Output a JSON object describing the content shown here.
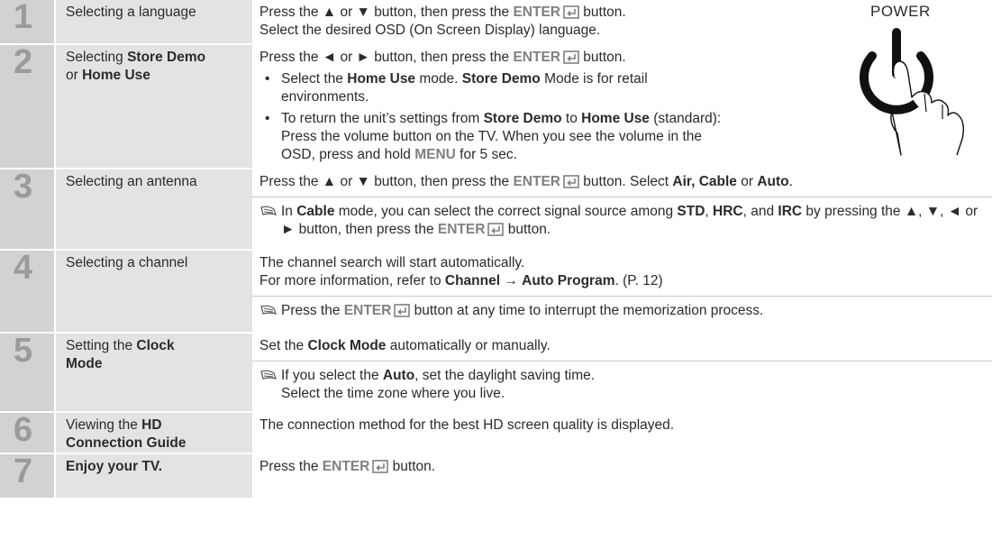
{
  "power_label": "POWER",
  "steps": [
    {
      "number": "1",
      "title_a": "Selecting a language",
      "title_b": "",
      "title_c": "",
      "title_d": ""
    },
    {
      "number": "2",
      "title_a": "Selecting ",
      "title_b": "Store Demo",
      "title_c": "or ",
      "title_d": "Home Use"
    },
    {
      "number": "3",
      "title_a": "Selecting an antenna"
    },
    {
      "number": "4",
      "title_a": "Selecting a channel"
    },
    {
      "number": "5",
      "title_a": "Setting the ",
      "title_b": "Clock",
      "title_c": "Mode"
    },
    {
      "number": "6",
      "title_a": "Viewing the ",
      "title_b": "HD",
      "title_c": "Connection Guide"
    },
    {
      "number": "7",
      "title_a": "Enjoy your TV."
    }
  ],
  "text": {
    "press_the": "Press the",
    "up_down": "▲ or ▼",
    "left_right": "◄ or ►",
    "button_then_press_the": "button, then press the",
    "enter": "ENTER",
    "button_period": "button.",
    "s1_line2": "Select the desired OSD (On Screen Display) language.",
    "s2_b1_a": "Select the ",
    "home_use": "Home Use",
    "s2_b1_b": " mode. ",
    "store_demo": "Store Demo",
    "s2_b1_c": " Mode is for retail environments.",
    "s2_b2_a": "To return the unit’s settings from ",
    "s2_b2_to": " to ",
    "s2_b2_b": " (standard): Press the volume button on the TV. When you see the volume in the OSD, press and hold ",
    "menu": "MENU",
    "s2_b2_c": " for 5 sec.",
    "s3_select": " Select ",
    "air_cable": "Air, Cable",
    "or": " or ",
    "auto": "Auto",
    "s3_note_a": "In ",
    "cable": "Cable",
    "s3_note_b": " mode, you can select the correct signal source among ",
    "std": "STD",
    "comma": ", ",
    "hrc": "HRC",
    "and": ", and ",
    "irc": "IRC",
    "s3_note_c": " by pressing the ▲, ▼, ◄ or ► button, then press the ",
    "s4_line1": "The channel search will start automatically.",
    "s4_line2_a": "For more information, refer to ",
    "channel": "Channel",
    "arrow": " → ",
    "auto_program": "Auto Program",
    "s4_line2_b": ". (P. 12)",
    "s4_note_a": "Press the ",
    "s4_note_b": " button at any time to interrupt the memorization process.",
    "s5_line1_a": "Set the ",
    "clock_mode": "Clock Mode",
    "s5_line1_b": " automatically or manually.",
    "s5_note_a": "If you select the ",
    "s5_note_b": ", set the daylight saving time.",
    "s5_note_c": "Select the time zone where you live.",
    "s6_line1": "The connection method for the best HD screen quality is displayed."
  }
}
